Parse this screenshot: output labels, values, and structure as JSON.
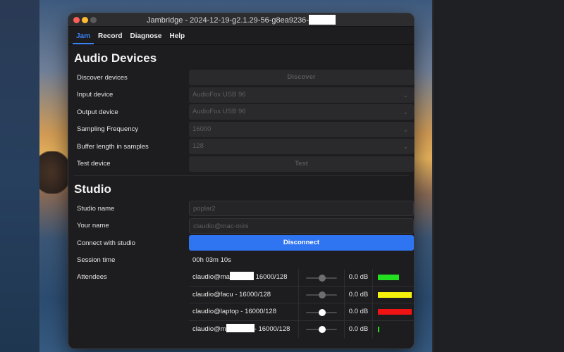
{
  "window": {
    "title_left": "Jambridge - 2024-12-19-g2.1.29-56-g8ea9236-"
  },
  "menu": [
    {
      "label": "Jam",
      "active": true
    },
    {
      "label": "Record",
      "active": false
    },
    {
      "label": "Diagnose",
      "active": false
    },
    {
      "label": "Help",
      "active": false
    }
  ],
  "audio_devices": {
    "title": "Audio Devices",
    "discover": {
      "label": "Discover devices",
      "button": "Discover"
    },
    "input": {
      "label": "Input device",
      "value": "AudioFox USB 96"
    },
    "output": {
      "label": "Output device",
      "value": "AudioFox USB 96"
    },
    "sampling": {
      "label": "Sampling Frequency",
      "value": "16000"
    },
    "buffer": {
      "label": "Buffer length in samples",
      "value": "128"
    },
    "test": {
      "label": "Test device",
      "button": "Test"
    }
  },
  "studio": {
    "title": "Studio",
    "studio_name": {
      "label": "Studio name",
      "value": "poplar2"
    },
    "your_name": {
      "label": "Your name",
      "value": "claudio@mac-mini"
    },
    "connect": {
      "label": "Connect with studio",
      "button": "Disconnect"
    },
    "session": {
      "label": "Session time",
      "value": "00h 03m 10s"
    },
    "attendees_label": "Attendees",
    "attendees": [
      {
        "name_pre": "claudio@ma",
        "redacted": true,
        "name_post": " 16000/128",
        "level_fraction": 0.5,
        "knob_color": "#6e6e70",
        "db": "0.0 dB",
        "meter_color": "#22e01f",
        "meter_fraction": 0.6
      },
      {
        "name_pre": "claudio@facu - 16000/128",
        "redacted": false,
        "name_post": "",
        "level_fraction": 0.5,
        "knob_color": "#6e6e70",
        "db": "0.0 dB",
        "meter_color": "#f5f00c",
        "meter_fraction": 0.96
      },
      {
        "name_pre": "claudio@laptop - 16000/128",
        "redacted": false,
        "name_post": "",
        "level_fraction": 0.5,
        "knob_color": "#ffffff",
        "db": "0.0 dB",
        "meter_color": "#f01313",
        "meter_fraction": 0.96
      },
      {
        "name_pre": "claudio@m",
        "redacted": true,
        "name_post": "- 16000/128",
        "level_fraction": 0.5,
        "knob_color": "#ffffff",
        "db": "0.0 dB",
        "meter_color": "#22e01f",
        "meter_fraction": 0.03
      }
    ]
  },
  "icons": {
    "dropdown": "chevron-down-icon"
  }
}
